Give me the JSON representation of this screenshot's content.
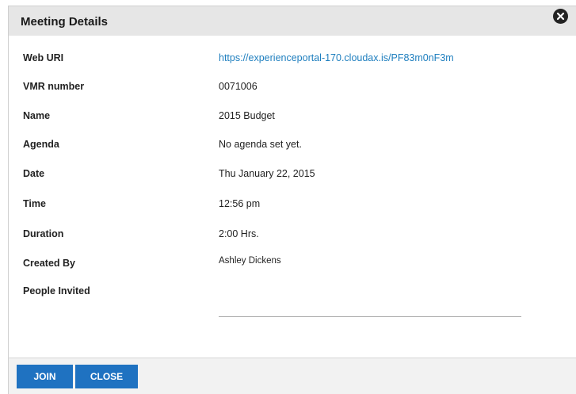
{
  "dialog": {
    "title": "Meeting Details"
  },
  "details": {
    "web_uri_label": "Web URI",
    "web_uri_value": "https://experienceportal-170.cloudax.is/PF83m0nF3m",
    "vmr_label": "VMR number",
    "vmr_value": "0071006",
    "name_label": "Name",
    "name_value": "2015 Budget",
    "agenda_label": "Agenda",
    "agenda_value": "No agenda set yet.",
    "date_label": "Date",
    "date_value": "Thu January 22, 2015",
    "time_label": "Time",
    "time_value": "12:56 pm",
    "duration_label": "Duration",
    "duration_value": "2:00 Hrs.",
    "created_by_label": "Created By",
    "created_by_value": "Ashley Dickens",
    "people_invited_label": "People Invited"
  },
  "footer": {
    "join_label": "JOIN",
    "close_label": "CLOSE"
  },
  "colors": {
    "link": "#1f7fbf",
    "button": "#1f72c1",
    "header_bg": "#e6e6e6"
  },
  "icons": {
    "close": "close-circle-icon"
  }
}
